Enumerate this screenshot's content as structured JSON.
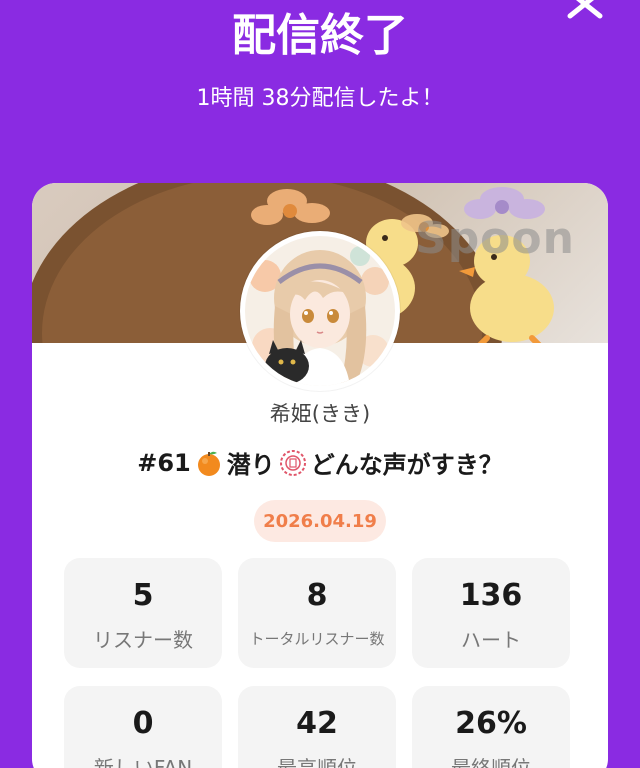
{
  "header": {
    "title": "配信終了",
    "subtitle": "1時間 38分配信したよ！"
  },
  "banner": {
    "watermark": "Spoon"
  },
  "profile": {
    "user_name": "希姫(きき)"
  },
  "live": {
    "title_prefix": "#61",
    "title_mid": "潜り",
    "title_suffix": "どんな声がすき？",
    "date": "2026.04.19"
  },
  "stats": [
    {
      "value": "5",
      "label": "リスナー数"
    },
    {
      "value": "8",
      "label": "トータルリスナー数"
    },
    {
      "value": "136",
      "label": "ハート"
    },
    {
      "value": "0",
      "label": "新しいFAN"
    },
    {
      "value": "42",
      "label": "最高順位"
    },
    {
      "value": "26%",
      "label": "最終順位"
    }
  ],
  "colors": {
    "background": "#8a2be2",
    "badge_bg": "#fde9e2",
    "badge_text": "#f07e4a",
    "stat_bg": "#f4f4f4"
  },
  "icons": {
    "close": "close-icon",
    "orange_emoji": "orange-emoji-icon",
    "seal_emoji": "seal-emoji-icon"
  }
}
